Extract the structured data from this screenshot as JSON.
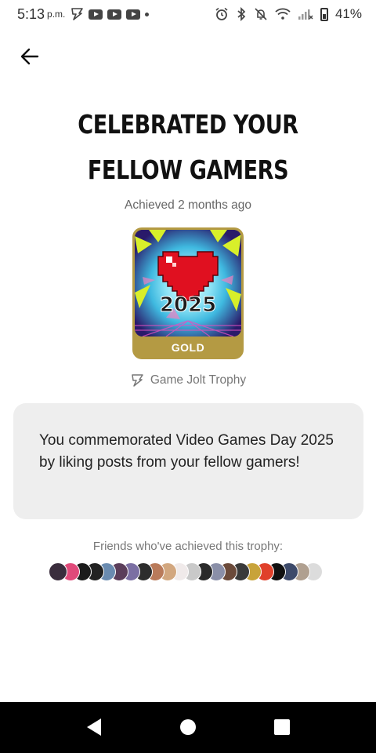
{
  "status_bar": {
    "time": "5:13",
    "ampm": "p.m.",
    "battery": "41%",
    "icons": [
      "gamejolt-icon",
      "youtube-icon",
      "youtube-icon",
      "youtube-icon",
      "notification-dot",
      "alarm-icon",
      "bluetooth-icon",
      "mute-icon",
      "wifi-icon",
      "signal-icon",
      "battery-icon"
    ]
  },
  "header": {
    "back_icon": "arrow-left-icon"
  },
  "trophy": {
    "title": "CELEBRATED YOUR FELLOW GAMERS",
    "achieved": "Achieved 2 months ago",
    "image_text": "2025",
    "tier": "GOLD",
    "tier_color": "#b49a43",
    "source_icon": "gamejolt-icon",
    "source": "Game Jolt Trophy",
    "description": "You commemorated Video Games Day 2025 by liking posts from your fellow gamers!"
  },
  "friends": {
    "label": "Friends who've achieved this trophy:",
    "avatar_colors": [
      "#3a2d3d",
      "#e04a7a",
      "#1b1b1b",
      "#222222",
      "#6a8bb0",
      "#5b3e5a",
      "#7b6fa3",
      "#2d2d2d",
      "#b97a5a",
      "#d2a77f",
      "#f0eaea",
      "#c9c9c9",
      "#2a2a2a",
      "#8a8fa8",
      "#6b4a3a",
      "#3a3a3a",
      "#c8a33a",
      "#e0402a",
      "#111111",
      "#3d4a6a",
      "#b0a090",
      "#dcdcdc"
    ]
  },
  "nav": {
    "back_icon": "nav-back-icon",
    "home_icon": "nav-home-icon",
    "recents_icon": "nav-recents-icon"
  }
}
